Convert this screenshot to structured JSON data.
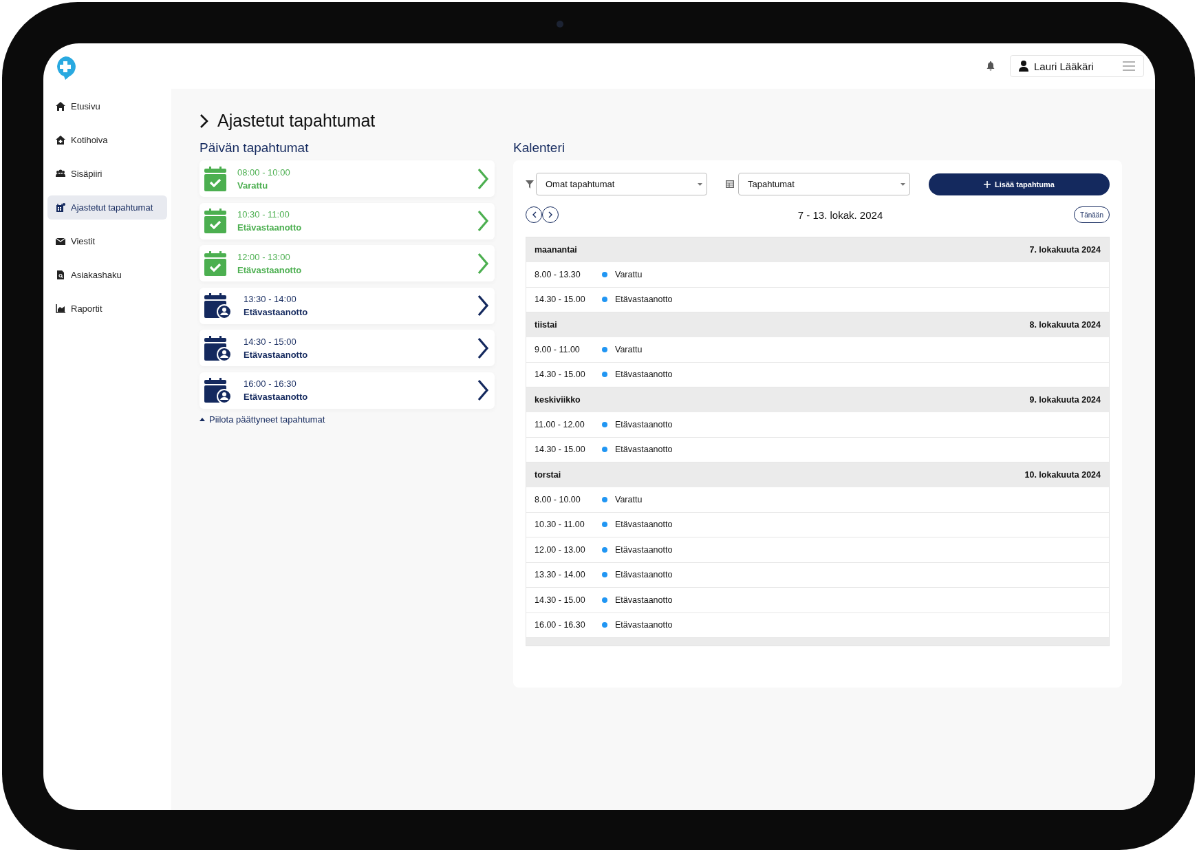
{
  "header": {
    "user": "Lauri Lääkäri"
  },
  "sidebar": {
    "items": [
      {
        "label": "Etusivu",
        "selected": false
      },
      {
        "label": "Kotihoiva",
        "selected": false
      },
      {
        "label": "Sisäpiiri",
        "selected": false
      },
      {
        "label": "Ajastetut tapahtumat",
        "selected": true
      },
      {
        "label": "Viestit",
        "selected": false
      },
      {
        "label": "Asiakashaku",
        "selected": false
      },
      {
        "label": "Raportit",
        "selected": false
      }
    ]
  },
  "page_title": "Ajastetut tapahtumat",
  "today": {
    "title": "Päivän tapahtumat",
    "events": [
      {
        "time": "08:00 - 10:00",
        "type": "Varattu",
        "kind": "done"
      },
      {
        "time": "10:30 - 11:00",
        "type": "Etävastaanotto",
        "kind": "done"
      },
      {
        "time": "12:00 - 13:00",
        "type": "Etävastaanotto",
        "kind": "done"
      },
      {
        "time": "13:30 - 14:00",
        "type": "Etävastaanotto",
        "kind": "upcoming"
      },
      {
        "time": "14:30 - 15:00",
        "type": "Etävastaanotto",
        "kind": "upcoming"
      },
      {
        "time": "16:00 - 16:30",
        "type": "Etävastaanotto",
        "kind": "upcoming"
      }
    ],
    "toggle": "Piilota päättyneet tapahtumat"
  },
  "calendar": {
    "title": "Kalenteri",
    "filter": "Omat tapahtumat",
    "view": "Tapahtumat",
    "add_button": "Lisää tapahtuma",
    "range": "7 - 13. lokak. 2024",
    "today_button": "Tänään",
    "days": [
      {
        "weekday": "maanantai",
        "date": "7. lokakuuta 2024",
        "events": [
          {
            "time": "8.00 - 13.30",
            "label": "Varattu",
            "color": "#2196f3"
          },
          {
            "time": "14.30 - 15.00",
            "label": "Etävastaanotto",
            "color": "#2196f3"
          }
        ]
      },
      {
        "weekday": "tiistai",
        "date": "8. lokakuuta 2024",
        "events": [
          {
            "time": "9.00 - 11.00",
            "label": "Varattu",
            "color": "#2196f3"
          },
          {
            "time": "14.30 - 15.00",
            "label": "Etävastaanotto",
            "color": "#2196f3"
          }
        ]
      },
      {
        "weekday": "keskiviikko",
        "date": "9. lokakuuta 2024",
        "events": [
          {
            "time": "11.00 - 12.00",
            "label": "Etävastaanotto",
            "color": "#2196f3"
          },
          {
            "time": "14.30 - 15.00",
            "label": "Etävastaanotto",
            "color": "#2196f3"
          }
        ]
      },
      {
        "weekday": "torstai",
        "date": "10. lokakuuta 2024",
        "events": [
          {
            "time": "8.00 - 10.00",
            "label": "Varattu",
            "color": "#2196f3"
          },
          {
            "time": "10.30 - 11.00",
            "label": "Etävastaanotto",
            "color": "#2196f3"
          },
          {
            "time": "12.00 - 13.00",
            "label": "Etävastaanotto",
            "color": "#2196f3"
          },
          {
            "time": "13.30 - 14.00",
            "label": "Etävastaanotto",
            "color": "#2196f3"
          },
          {
            "time": "14.30 - 15.00",
            "label": "Etävastaanotto",
            "color": "#2196f3"
          },
          {
            "time": "16.00 - 16.30",
            "label": "Etävastaanotto",
            "color": "#2196f3"
          }
        ]
      }
    ]
  }
}
